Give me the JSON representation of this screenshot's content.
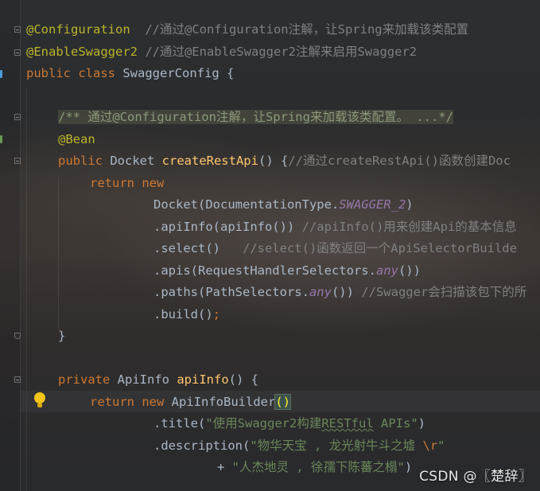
{
  "code_lines": [
    {
      "id": "l1",
      "tokens": [
        {
          "t": "@Configuration",
          "c": "ann"
        },
        {
          "t": "  //通过@Configuration注解，让Spring来加载该类配置",
          "c": "cmt"
        }
      ]
    },
    {
      "id": "l2",
      "tokens": [
        {
          "t": "@EnableSwagger2",
          "c": "ann"
        },
        {
          "t": " //通过@EnableSwagger2注解来启用Swagger2",
          "c": "cmt"
        }
      ]
    },
    {
      "id": "l3",
      "tokens": [
        {
          "t": "public",
          "c": "kw"
        },
        {
          "t": " ",
          "c": ""
        },
        {
          "t": "class",
          "c": "kw"
        },
        {
          "t": " SwaggerConfig {",
          "c": ""
        }
      ]
    },
    {
      "id": "l4",
      "tokens": []
    },
    {
      "id": "l5",
      "tokens": [
        {
          "t": "/** 通过@Configuration注解，让Spring来加载该类配置。 ...*/",
          "c": "doc"
        }
      ]
    },
    {
      "id": "l6",
      "tokens": [
        {
          "t": "@Bean",
          "c": "ann"
        }
      ]
    },
    {
      "id": "l7",
      "tokens": [
        {
          "t": "public",
          "c": "kw"
        },
        {
          "t": " Docket ",
          "c": ""
        },
        {
          "t": "createRestApi",
          "c": "fn"
        },
        {
          "t": "() {",
          "c": ""
        },
        {
          "t": "//通过createRestApi()函数创建Doc",
          "c": "cmt"
        }
      ]
    },
    {
      "id": "l8",
      "tokens": [
        {
          "t": "return",
          "c": "kw"
        },
        {
          "t": " ",
          "c": ""
        },
        {
          "t": "new",
          "c": "kw"
        }
      ]
    },
    {
      "id": "l9",
      "tokens": [
        {
          "t": "Docket(DocumentationType.",
          "c": ""
        },
        {
          "t": "SWAGGER_2",
          "c": "st"
        },
        {
          "t": ")",
          "c": ""
        }
      ]
    },
    {
      "id": "l10",
      "tokens": [
        {
          "t": ".apiInfo(apiInfo()) ",
          "c": ""
        },
        {
          "t": "//apiInfo()用来创建Api的基本信息",
          "c": "cmt"
        }
      ]
    },
    {
      "id": "l11",
      "tokens": [
        {
          "t": ".select()   ",
          "c": ""
        },
        {
          "t": "//select()函数返回一个ApiSelectorBuilde",
          "c": "cmt"
        }
      ]
    },
    {
      "id": "l12",
      "tokens": [
        {
          "t": ".apis(RequestHandlerSelectors.",
          "c": ""
        },
        {
          "t": "any",
          "c": "st"
        },
        {
          "t": "())",
          "c": ""
        }
      ]
    },
    {
      "id": "l13",
      "tokens": [
        {
          "t": ".paths(PathSelectors.",
          "c": ""
        },
        {
          "t": "any",
          "c": "st"
        },
        {
          "t": "()) ",
          "c": ""
        },
        {
          "t": "//Swagger会扫描该包下的所",
          "c": "cmt"
        }
      ]
    },
    {
      "id": "l14",
      "tokens": [
        {
          "t": ".build()",
          "c": ""
        },
        {
          "t": ";",
          "c": "kw"
        }
      ]
    },
    {
      "id": "l15",
      "tokens": [
        {
          "t": "}",
          "c": ""
        }
      ]
    },
    {
      "id": "l16",
      "tokens": []
    },
    {
      "id": "l17",
      "tokens": [
        {
          "t": "private",
          "c": "kw"
        },
        {
          "t": " ApiInfo ",
          "c": ""
        },
        {
          "t": "apiInfo",
          "c": "fn"
        },
        {
          "t": "() {",
          "c": ""
        }
      ]
    },
    {
      "id": "l18",
      "tokens": [
        {
          "t": "return",
          "c": "kw"
        },
        {
          "t": " ",
          "c": ""
        },
        {
          "t": "new",
          "c": "kw"
        },
        {
          "t": " ApiInfoBuilder",
          "c": ""
        },
        {
          "t": "()",
          "c": "brace"
        }
      ]
    },
    {
      "id": "l19",
      "tokens": [
        {
          "t": ".title(",
          "c": ""
        },
        {
          "t": "\"使用Swagger2构建",
          "c": "str"
        },
        {
          "t": "RESTful",
          "c": "str squig"
        },
        {
          "t": " APIs\"",
          "c": "str"
        },
        {
          "t": ")",
          "c": ""
        }
      ]
    },
    {
      "id": "l20",
      "tokens": [
        {
          "t": ".description(",
          "c": ""
        },
        {
          "t": "\"物华天宝 , 龙光射牛斗之墟 ",
          "c": "str"
        },
        {
          "t": "\\r",
          "c": "esc"
        },
        {
          "t": "\"",
          "c": "str"
        }
      ]
    },
    {
      "id": "l21",
      "tokens": [
        {
          "t": "+ ",
          "c": ""
        },
        {
          "t": "\"人杰地灵 , 徐孺下陈蕃之榻\"",
          "c": "str"
        },
        {
          "t": ")",
          "c": ""
        }
      ]
    }
  ],
  "watermark": "CSDN @〖楚辞〗",
  "icons": {
    "intention": "lightbulb-icon",
    "fold": "fold-marker-icon"
  },
  "colors": {
    "keyword": "#cc7832",
    "annotation": "#bbb529",
    "comment": "#808080",
    "function": "#ffc66d",
    "static_field": "#9876aa",
    "string": "#6a8759",
    "plain": "#a9b7c6"
  }
}
